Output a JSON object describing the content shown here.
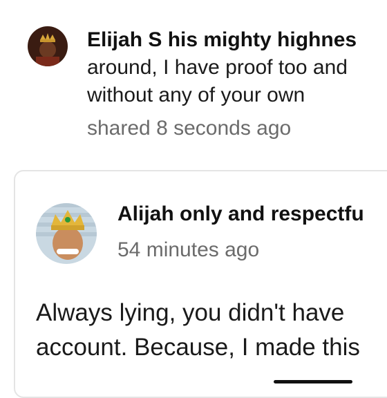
{
  "comment_top": {
    "author": "Elijah S his mighty highnes",
    "text_lines": [
      "around, I have proof too and",
      "without any of your own"
    ],
    "meta": "shared 8 seconds ago",
    "avatar_icon": "crowned-person-avatar"
  },
  "comment_card": {
    "author": "Alijah only and respectfu",
    "meta": "54 minutes ago",
    "text_lines": [
      "Always lying, you didn't have",
      "account. Because, I made this"
    ],
    "avatar_icon": "crowned-face-avatar"
  }
}
